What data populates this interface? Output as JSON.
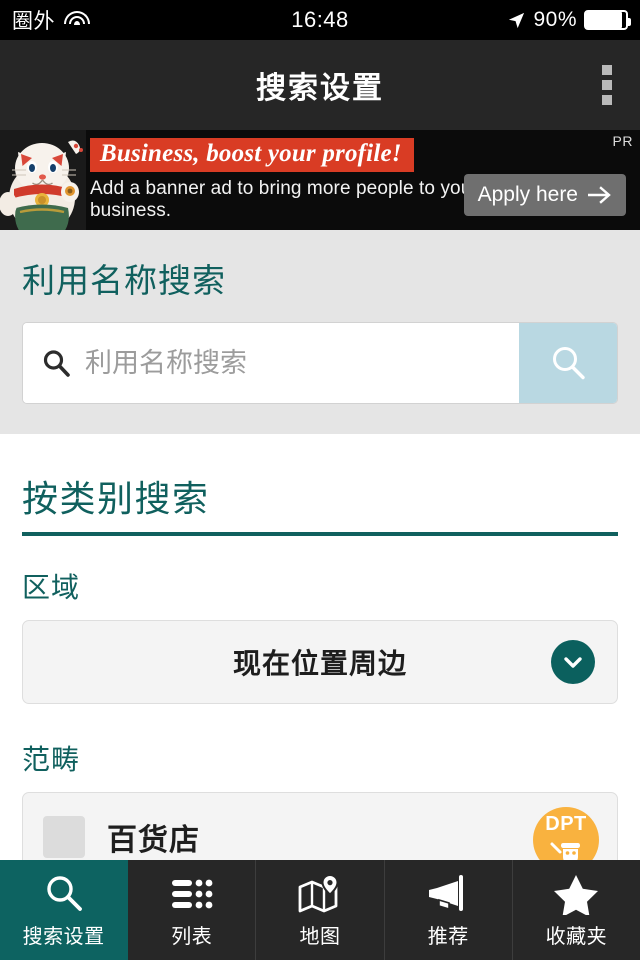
{
  "statusbar": {
    "carrier": "圈外",
    "wifi_icon": "wifi-icon",
    "time": "16:48",
    "location_icon": "location-arrow-icon",
    "battery_percent": "90%",
    "battery_level": 90,
    "battery_icon": "battery-icon"
  },
  "header": {
    "title": "搜索设置",
    "menu_icon": "kebab-menu-icon"
  },
  "ad": {
    "pr_label": "PR",
    "headline": "Business, boost your profile!",
    "body": "Add a banner ad to bring more people to your business.",
    "cta_label": "Apply here",
    "cta_arrow": "arrow-right-icon",
    "image_icon": "maneki-neko-cat-image",
    "headline_color": "#d93c24",
    "background_color": "#0b0b0b"
  },
  "name_search": {
    "heading": "利用名称搜索",
    "input_value": "",
    "input_placeholder": "利用名称搜索",
    "field_icon": "search-icon",
    "button_icon": "search-icon",
    "button_color": "#b9d8e2"
  },
  "category_search": {
    "heading": "按类别搜索",
    "accent_color": "#10605e",
    "region": {
      "label": "区域",
      "selected": "现在位置周边",
      "chevron_icon": "chevron-down-icon"
    },
    "category": {
      "label": "范畴",
      "items": [
        {
          "name": "百货店",
          "checked": false,
          "badge": "DPT",
          "badge_color": "#f9b23f",
          "badge_icon": "dpt-character-icon"
        }
      ]
    }
  },
  "tabbar": {
    "active_color": "#0d6361",
    "items": [
      {
        "label": "搜索设置",
        "icon": "search-icon",
        "active": true
      },
      {
        "label": "列表",
        "icon": "list-icon",
        "active": false
      },
      {
        "label": "地图",
        "icon": "map-pin-icon",
        "active": false
      },
      {
        "label": "推荐",
        "icon": "megaphone-icon",
        "active": false
      },
      {
        "label": "收藏夹",
        "icon": "star-icon",
        "active": false
      }
    ]
  }
}
